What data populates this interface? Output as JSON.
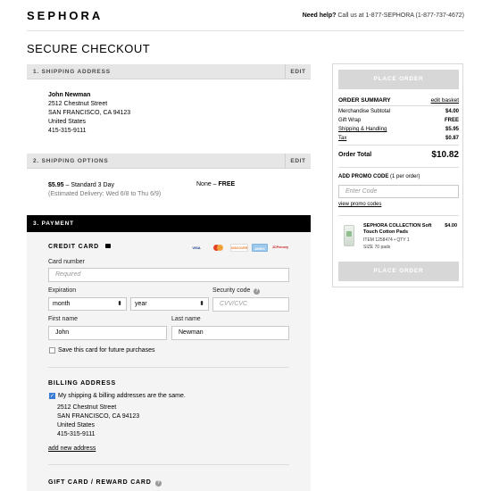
{
  "header": {
    "logo": "SEPHORA",
    "help_label": "Need help?",
    "help_text": " Call us at 1-877-SEPHORA (1-877-737-4672)"
  },
  "page_title": "SECURE CHECKOUT",
  "shipping_address": {
    "heading": "1. SHIPPING ADDRESS",
    "edit": "EDIT",
    "name": "John Newman",
    "street": "2512 Chestnut Street",
    "city": "SAN FRANCISCO, CA 94123",
    "country": "United States",
    "phone": "415-315-9111"
  },
  "shipping_options": {
    "heading": "2. SHIPPING OPTIONS",
    "edit": "EDIT",
    "price": "$5.95",
    "method": " – Standard 3 Day",
    "estimate": "(Estimated Delivery: Wed 6/8 to Thu 6/9)",
    "gift": "None – ",
    "gift_value": "FREE"
  },
  "payment": {
    "heading": "3. PAYMENT",
    "credit_card_heading": "CREDIT CARD",
    "cards": [
      "VISA",
      "MC",
      "DISCOVER",
      "AMEX",
      "JCPenney"
    ],
    "card_number_label": "Card number",
    "card_number_placeholder": "Required",
    "expiration_label": "Expiration",
    "month_value": "month",
    "year_value": "year",
    "security_label": "Security code",
    "security_placeholder": "CVV/CVC",
    "first_name_label": "First name",
    "first_name_value": "John",
    "last_name_label": "Last name",
    "last_name_value": "Newman",
    "save_card_label": "Save this card for future purchases",
    "billing_heading": "BILLING ADDRESS",
    "same_address_label": "My shipping & billing addresses are the same.",
    "billing_street": "2512 Chestnut Street",
    "billing_city": "SAN FRANCISCO, CA 94123",
    "billing_country": "United States",
    "billing_phone": "415-315-9111",
    "add_address_link": "add new address",
    "gift_card_heading": "GIFT CARD / REWARD CARD"
  },
  "summary": {
    "place_order": "PLACE ORDER",
    "heading": "ORDER SUMMARY",
    "edit_basket": "edit basket",
    "rows": [
      {
        "label": "Merchandise Subtotal",
        "value": "$4.00"
      },
      {
        "label": "Gift Wrap",
        "value": "FREE"
      },
      {
        "label": "Shipping & Handling",
        "value": "$5.95"
      },
      {
        "label": "Tax",
        "value": "$0.87"
      }
    ],
    "total_label": "Order Total",
    "total_value": "$10.82",
    "promo_heading": "ADD PROMO CODE",
    "promo_note": " (1 per order)",
    "promo_placeholder": "Enter Code",
    "view_promo": "view promo codes",
    "product_name": "SEPHORA COLLECTION Soft Touch Cotton Pads",
    "product_price": "$4.00",
    "product_item": "ITEM 1258474",
    "product_qty": "QTY 1",
    "product_size": "SIZE 70 pads"
  }
}
